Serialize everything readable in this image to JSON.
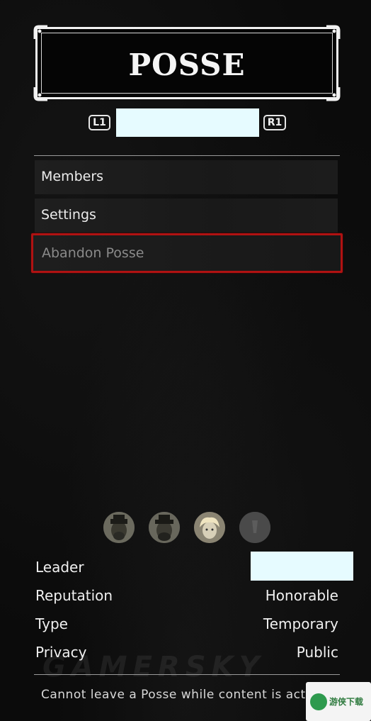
{
  "header": {
    "title": "POSSE",
    "left_bumper": "L1",
    "right_bumper": "R1"
  },
  "menu": {
    "items": [
      {
        "label": "Members",
        "state": "enabled"
      },
      {
        "label": "Settings",
        "state": "enabled"
      },
      {
        "label": "Abandon Posse",
        "state": "disabled-selected"
      }
    ]
  },
  "members": {
    "avatars": [
      "member-portrait",
      "member-portrait",
      "member-portrait",
      "empty-slot"
    ]
  },
  "details": {
    "leader_label": "Leader",
    "reputation_label": "Reputation",
    "reputation_value": "Honorable",
    "type_label": "Type",
    "type_value": "Temporary",
    "privacy_label": "Privacy",
    "privacy_value": "Public"
  },
  "footer": {
    "message": "Cannot leave a Posse while content is activ",
    "watermark": "GAMERSKY",
    "badge_text": "游侠下载"
  },
  "colors": {
    "selection_border": "#b01212",
    "redaction": "#e6fbff",
    "badge_green": "#2e9a4e"
  }
}
